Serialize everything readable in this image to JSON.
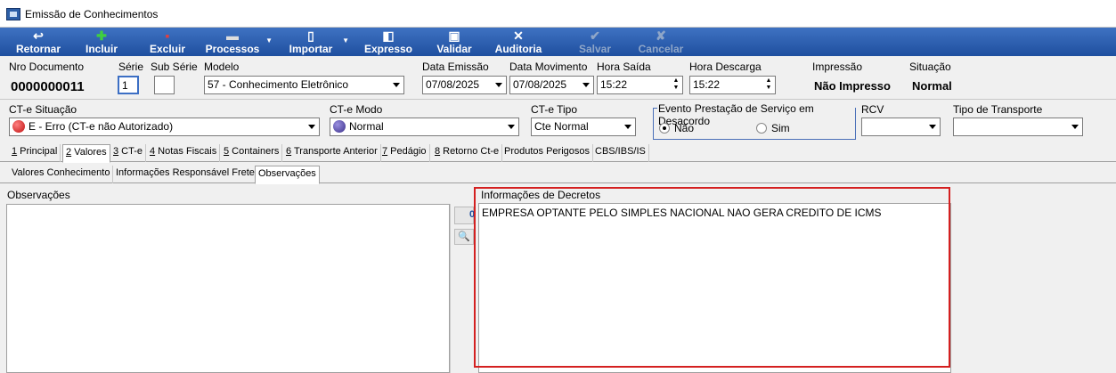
{
  "window": {
    "title": "Emissão de Conhecimentos"
  },
  "toolbar": {
    "buttons": [
      {
        "label": "Retornar",
        "icon": "undo-icon"
      },
      {
        "label": "Incluir",
        "icon": "plus-icon"
      },
      {
        "label": "Excluir",
        "icon": "delete-icon"
      },
      {
        "label": "Processos",
        "icon": "printer-icon"
      },
      {
        "label": "Importar",
        "icon": "import-icon"
      },
      {
        "label": "Expresso",
        "icon": "express-icon"
      },
      {
        "label": "Validar",
        "icon": "validate-icon"
      },
      {
        "label": "Auditoria",
        "icon": "tools-icon"
      },
      {
        "label": "Salvar",
        "icon": "check-icon"
      },
      {
        "label": "Cancelar",
        "icon": "cancel-icon"
      }
    ]
  },
  "header": {
    "nro_documento_label": "Nro Documento",
    "nro_documento": "0000000011",
    "serie_label": "Série",
    "serie": "1",
    "subserie_label": "Sub Série",
    "subserie": "",
    "modelo_label": "Modelo",
    "modelo": "57 - Conhecimento Eletrônico",
    "data_emissao_label": "Data Emissão",
    "data_emissao": "07/08/2025",
    "data_movimento_label": "Data Movimento",
    "data_movimento": "07/08/2025",
    "hora_saida_label": "Hora Saída",
    "hora_saida": "15:22",
    "hora_descarga_label": "Hora Descarga",
    "hora_descarga": "15:22",
    "impressao_label": "Impressão",
    "impressao": "Não Impresso",
    "situacao_label": "Situação",
    "situacao": "Normal"
  },
  "row2": {
    "cte_situacao_label": "CT-e Situação",
    "cte_situacao": "E - Erro (CT-e não Autorizado)",
    "cte_modo_label": "CT-e Modo",
    "cte_modo": "Normal",
    "cte_tipo_label": "CT-e Tipo",
    "cte_tipo": "Cte Normal",
    "evento_label": "Evento Prestação de Serviço em Desacordo",
    "evento_nao": "Não",
    "evento_sim": "Sim",
    "rcv_label": "RCV",
    "rcv": "",
    "tipo_transporte_label": "Tipo de Transporte",
    "tipo_transporte": ""
  },
  "tabs_main": [
    {
      "key": "1",
      "label": " Principal"
    },
    {
      "key": "2",
      "label": " Valores"
    },
    {
      "key": "3",
      "label": " CT-e"
    },
    {
      "key": "4",
      "label": " Notas Fiscais"
    },
    {
      "key": "5",
      "label": " Containers"
    },
    {
      "key": "6",
      "label": " Transporte Anterior"
    },
    {
      "key": "7",
      "label": " Pedágio"
    },
    {
      "key": "8",
      "label": " Retorno Ct-e"
    },
    {
      "key": "",
      "label": "Produtos Perigosos"
    },
    {
      "key": "",
      "label": "CBS/IBS/IS"
    }
  ],
  "tabs_sub": [
    "Valores Conhecimento",
    "Informações Responsável Frete",
    "Observações"
  ],
  "observacoes": {
    "label": "Observações",
    "text": ""
  },
  "decretos": {
    "label": "Informações de Decretos",
    "text": "EMPRESA OPTANTE PELO SIMPLES NACIONAL NAO GERA CREDITO DE ICMS"
  },
  "mini_button_label": "0",
  "colors": {
    "toolbar": "#2a5db0",
    "highlight": "#d42020",
    "status_dot_error": "#d42020",
    "status_dot_normal": "#4a3fa0"
  }
}
